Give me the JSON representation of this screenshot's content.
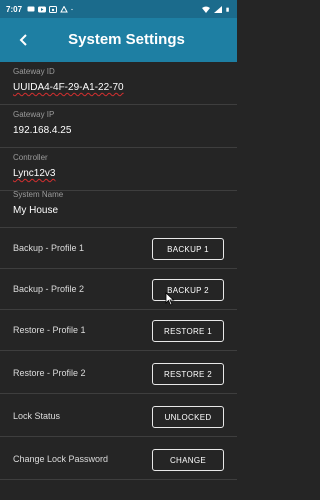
{
  "status_bar": {
    "time": "7:07",
    "left_icons": [
      "message-icon",
      "youtube-icon",
      "cast-icon",
      "notification-icon",
      "dot-icon"
    ],
    "right_icons": [
      "wifi-icon",
      "signal-icon",
      "battery-icon"
    ]
  },
  "header": {
    "title": "System Settings",
    "back_icon": "chevron-left-icon",
    "color": "#1e7fa3"
  },
  "fields": [
    {
      "label": "Gateway ID",
      "value": "UUIDA4-4F-29-A1-22-70"
    },
    {
      "label": "Gateway IP",
      "value": "192.168.4.25"
    },
    {
      "label": "Controller",
      "value": "Lync12v3"
    },
    {
      "label": "System Name",
      "value": "My House"
    }
  ],
  "rows": [
    {
      "label": "Backup - Profile 1",
      "button": "BACKUP 1"
    },
    {
      "label": "Backup - Profile 2",
      "button": "BACKUP 2"
    },
    {
      "label": "Restore - Profile 1",
      "button": "RESTORE 1"
    },
    {
      "label": "Restore - Profile 2",
      "button": "RESTORE 2"
    },
    {
      "label": "Lock Status",
      "button": "UNLOCKED"
    },
    {
      "label": "Change Lock Password",
      "button": "CHANGE"
    }
  ]
}
